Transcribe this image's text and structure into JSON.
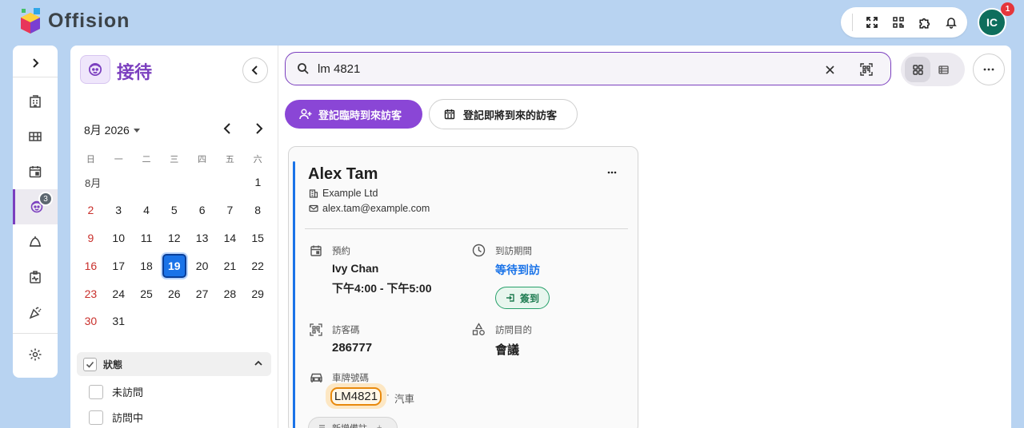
{
  "app": {
    "logo_text": "Offision"
  },
  "topbar": {
    "avatar_initials": "IC",
    "notification_count": "1",
    "icons": [
      "fullscreen-icon",
      "qr-scan-icon",
      "puzzle-icon",
      "bell-icon"
    ]
  },
  "rail": {
    "items": [
      {
        "name": "expand",
        "icon": "chevron-right-icon"
      },
      {
        "name": "building",
        "icon": "building-icon"
      },
      {
        "name": "floorplan",
        "icon": "grid-layout-icon"
      },
      {
        "name": "calendar",
        "icon": "calendar-icon"
      },
      {
        "name": "reception",
        "icon": "visitor-icon",
        "badge": "3",
        "active": true
      },
      {
        "name": "delivery",
        "icon": "bell-delivery-icon"
      },
      {
        "name": "health",
        "icon": "health-check-icon"
      },
      {
        "name": "events",
        "icon": "party-icon"
      },
      {
        "name": "settings",
        "icon": "gear-icon"
      }
    ]
  },
  "panel": {
    "title": "接待",
    "month_label": "8月 2026",
    "weekdays": [
      "日",
      "一",
      "二",
      "三",
      "四",
      "五",
      "六"
    ],
    "month_short": "8月",
    "weeks": [
      [
        "",
        "",
        "",
        "",
        "",
        "",
        "1"
      ],
      [
        "2",
        "3",
        "4",
        "5",
        "6",
        "7",
        "8"
      ],
      [
        "9",
        "10",
        "11",
        "12",
        "13",
        "14",
        "15"
      ],
      [
        "16",
        "17",
        "18",
        "19",
        "20",
        "21",
        "22"
      ],
      [
        "23",
        "24",
        "25",
        "26",
        "27",
        "28",
        "29"
      ],
      [
        "30",
        "31",
        "",
        "",
        "",
        "",
        ""
      ]
    ],
    "selected_day": "19",
    "status_header": "狀態",
    "status_options": [
      "未訪問",
      "訪問中"
    ]
  },
  "main": {
    "search": {
      "value": "lm 4821"
    },
    "btn_walkin": "登記臨時到來訪客",
    "btn_upcoming": "登記即將到來的訪客"
  },
  "card": {
    "name": "Alex Tam",
    "company": "Example Ltd",
    "email": "alex.tam@example.com",
    "booking_label": "預約",
    "host": "Ivy Chan",
    "time": "下午4:00 - 下午5:00",
    "period_label": "到訪期間",
    "status": "等待到訪",
    "checkin_label": "簽到",
    "code_label": "訪客碼",
    "code": "286777",
    "purpose_label": "訪問目的",
    "purpose": "會議",
    "plate_label": "車牌號碼",
    "plate": "LM4821",
    "vehicle_sep": "·",
    "vehicle_type": "汽車",
    "add_note": "新增備註"
  },
  "colors": {
    "accent_purple": "#7b3fbf",
    "primary_button": "#8a46d6",
    "selected_day": "#1a73e8",
    "status_link": "#1a73e8",
    "checkin_green": "#27a06a",
    "plate_highlight": "#e8890c"
  }
}
